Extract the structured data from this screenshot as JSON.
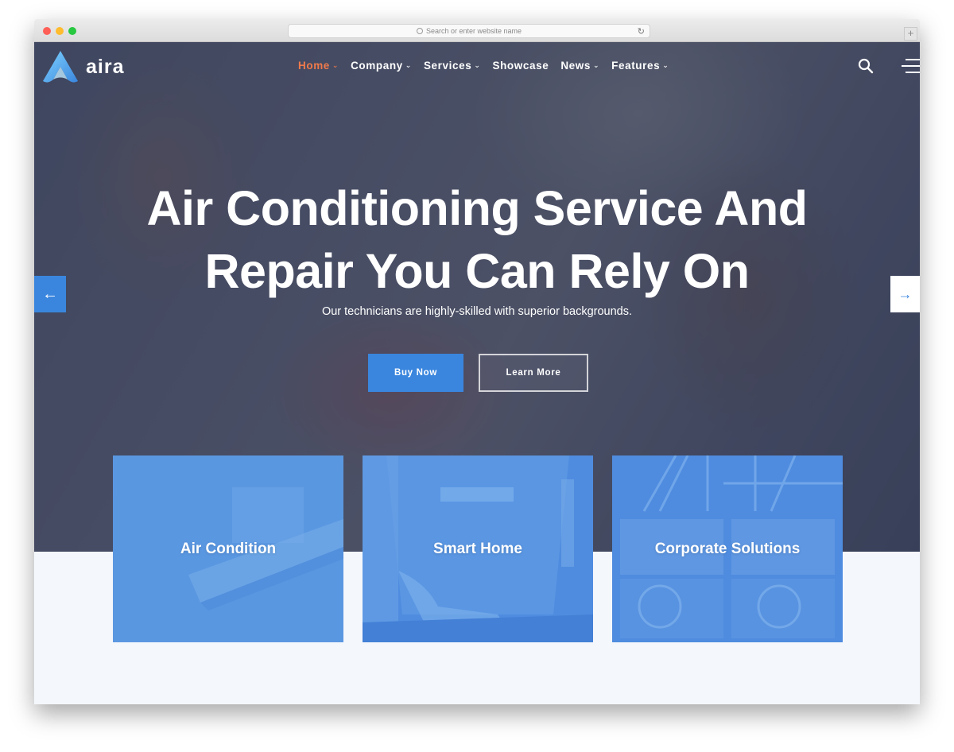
{
  "browser": {
    "url_placeholder": "Search or enter website name",
    "reload_icon": "reload-icon",
    "new_tab_label": "+"
  },
  "site": {
    "logo_text": "aira",
    "colors": {
      "accent": "#3a86de",
      "nav_active": "#f07a4b",
      "section_bg": "#f4f7fc"
    }
  },
  "nav": {
    "items": [
      {
        "label": "Home",
        "dropdown": true,
        "active": true
      },
      {
        "label": "Company",
        "dropdown": true
      },
      {
        "label": "Services",
        "dropdown": true
      },
      {
        "label": "Showcase",
        "dropdown": false
      },
      {
        "label": "News",
        "dropdown": true
      },
      {
        "label": "Features",
        "dropdown": true
      }
    ],
    "caret": "⌄",
    "search_icon": "search-icon",
    "menu_icon": "hamburger-menu-icon"
  },
  "hero": {
    "title_line1": "Air Conditioning Service And",
    "title_line2": "Repair You Can Rely On",
    "subtitle": "Our technicians are highly-skilled with superior backgrounds.",
    "buy_label": "Buy Now",
    "learn_label": "Learn More",
    "prev_arrow": "←",
    "next_arrow": "→"
  },
  "cards": [
    {
      "label": "Air Condition"
    },
    {
      "label": "Smart Home"
    },
    {
      "label": "Corporate Solutions"
    }
  ]
}
